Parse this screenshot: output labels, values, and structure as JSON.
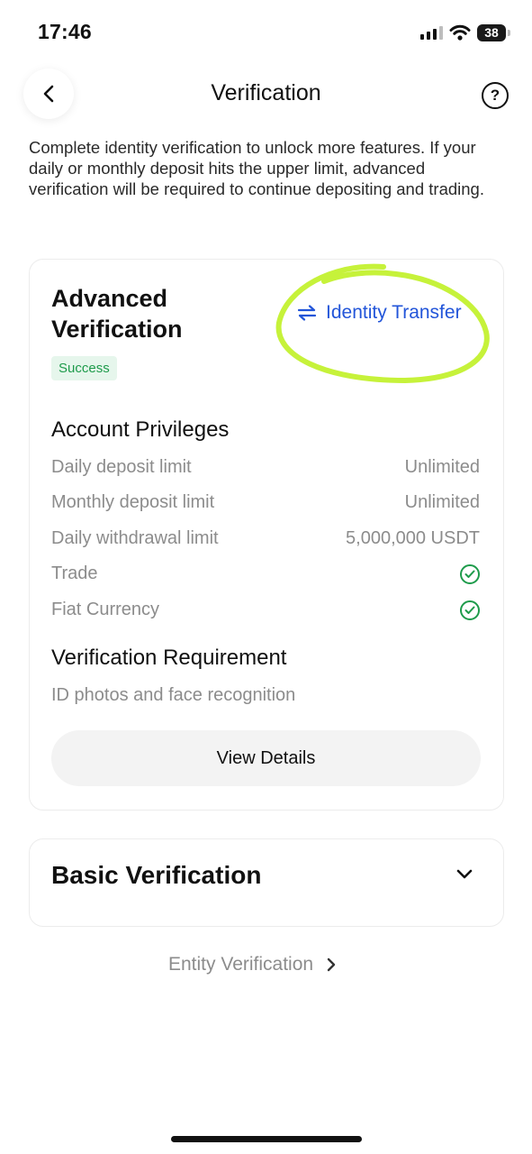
{
  "status_bar": {
    "time": "17:46",
    "battery": "38",
    "icons": [
      "signal-icon",
      "wifi-icon",
      "battery-icon"
    ]
  },
  "header": {
    "title": "Verification",
    "back_icon": "chevron-left-icon",
    "help_icon": "question-circle-icon",
    "help_glyph": "?"
  },
  "intro_text": "Complete identity verification to unlock more features. If your daily or monthly deposit hits the upper limit, advanced verification will be required to continue depositing and trading.",
  "advanced": {
    "title": "Advanced Verification",
    "identity_transfer_label": "Identity Transfer",
    "identity_transfer_icon": "swap-arrows-icon",
    "status_badge": "Success",
    "privileges_title": "Account Privileges",
    "privileges": [
      {
        "label": "Daily deposit limit",
        "value": "Unlimited"
      },
      {
        "label": "Monthly deposit limit",
        "value": "Unlimited"
      },
      {
        "label": "Daily withdrawal limit",
        "value": "5,000,000 USDT"
      },
      {
        "label": "Trade",
        "value": "check-circle-icon"
      },
      {
        "label": "Fiat Currency",
        "value": "check-circle-icon"
      }
    ],
    "requirement_title": "Verification Requirement",
    "requirement_text": "ID photos and face recognition",
    "view_details_label": "View Details"
  },
  "basic": {
    "title": "Basic Verification",
    "expand_icon": "chevron-down-icon"
  },
  "entity_link": {
    "label": "Entity Verification",
    "icon": "chevron-right-icon"
  },
  "colors": {
    "accent_link": "#2255d9",
    "success": "#1e9b4b",
    "success_bg": "#e6f6ec",
    "annotation": "#c6f23a",
    "muted_text": "#8c8c8c"
  }
}
